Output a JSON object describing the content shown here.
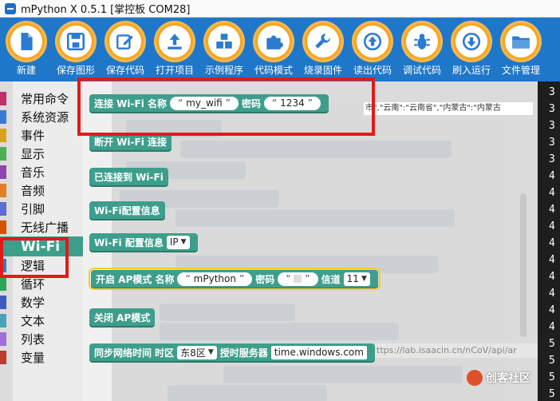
{
  "window": {
    "title": "mPython X 0.5.1 [掌控板 COM28]"
  },
  "toolbar": {
    "buttons": [
      {
        "label": "新建",
        "icon": "new-file-icon"
      },
      {
        "label": "保存图形",
        "icon": "save-icon"
      },
      {
        "label": "保存代码",
        "icon": "edit-icon"
      },
      {
        "label": "打开项目",
        "icon": "upload-icon"
      },
      {
        "label": "示例程序",
        "icon": "cubes-icon"
      },
      {
        "label": "代码模式",
        "icon": "puzzle-icon"
      },
      {
        "label": "烧录固件",
        "icon": "wrench-icon"
      },
      {
        "label": "读出代码",
        "icon": "arrow-up-icon"
      },
      {
        "label": "调试代码",
        "icon": "bug-icon"
      },
      {
        "label": "刷入运行",
        "icon": "arrow-down-icon"
      },
      {
        "label": "文件管理",
        "icon": "folder-icon"
      }
    ]
  },
  "categories": [
    {
      "label": "常用命令",
      "color": "#c0306a"
    },
    {
      "label": "系统资源",
      "color": "#3a7bd5"
    },
    {
      "label": "事件",
      "color": "#d9a21b"
    },
    {
      "label": "显示",
      "color": "#4caf50"
    },
    {
      "label": "音乐",
      "color": "#8e44ad"
    },
    {
      "label": "音频",
      "color": "#e67e22"
    },
    {
      "label": "引脚",
      "color": "#5b6cd4"
    },
    {
      "label": "无线广播",
      "color": "#d35400"
    },
    {
      "label": "Wi-Fi",
      "color": "#3e9e8c",
      "selected": true
    },
    {
      "label": "逻辑",
      "color": "#2f7fc1"
    },
    {
      "label": "循环",
      "color": "#2aa55a"
    },
    {
      "label": "数学",
      "color": "#3c5cbf"
    },
    {
      "label": "文本",
      "color": "#47a3b8"
    },
    {
      "label": "列表",
      "color": "#a06ed6"
    },
    {
      "label": "变量",
      "color": "#c0392b"
    }
  ],
  "blocks": {
    "connect_wifi": {
      "label": "连接 Wi-Fi 名称",
      "ssid": "my_wifi",
      "password_label": "密码",
      "password": "1234"
    },
    "disconnect_wifi": {
      "label": "断开 Wi-Fi 连接"
    },
    "connected": {
      "label": "已连接到 Wi-Fi"
    },
    "config_info": {
      "label": "Wi-Fi配置信息"
    },
    "config_info_param": {
      "label": "Wi-Fi 配置信息",
      "option": "IP"
    },
    "ap_mode": {
      "label": "开启 AP模式 名称",
      "name": "mPython",
      "password_label": "密码",
      "password": "",
      "channel_label": "信道",
      "channel": "11"
    },
    "close_ap": {
      "label": "关闭 AP模式"
    },
    "sync_time": {
      "label": "同步网络时间 时区",
      "timezone": "东8区",
      "server_label": "授时服务器",
      "server": "time.windows.com"
    }
  },
  "background": {
    "url_text": "市\",\"云南\":\"云南省\",\"内蒙古\":\"内蒙古",
    "url_text2": "ttps://lab.isaacin.cn/nCoV/api/ar"
  },
  "right_panel": {
    "line_numbers": [
      "3",
      "3",
      "3",
      "3",
      "3",
      "4",
      "4",
      "4",
      "4",
      "4",
      "4",
      "4",
      "4",
      "4",
      "4",
      "5",
      "5",
      "5",
      "5"
    ]
  },
  "watermark": {
    "text": "创客社区"
  },
  "colors": {
    "toolbar_bg": "#1f77c9",
    "tool_circle": "#f6a623",
    "wifi_block": "#3e9e8c",
    "annotation": "#e21a1a"
  }
}
